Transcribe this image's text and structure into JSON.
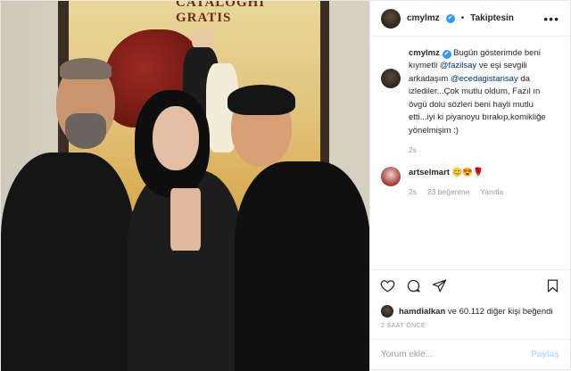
{
  "poster": {
    "text": "CATALOGHI GRATIS"
  },
  "header": {
    "username": "cmylmz",
    "verified": "✔",
    "separator": "•",
    "follow_label": "Takiptesin",
    "menu": "•••"
  },
  "caption": {
    "username": "cmylmz",
    "verified": "✔",
    "text_1": "Bugün gösterimde beni kıymetli",
    "mention_1": "@fazilsay",
    "text_2": "ve eşi sevgili arkadaşım",
    "mention_2": "@ecedagistansay",
    "text_3": "da izlediler...Çok mutlu oldum, Fazıl ın övgü dolu sözleri beni hayli mutlu etti...iyi ki piyanoyu bırakıp,komikliğe yönelmişim :)",
    "age": "2s"
  },
  "comments": [
    {
      "username": "artselmart",
      "text": "😊😍🌹",
      "age": "2s",
      "likes": "23 beğenme",
      "reply": "Yanıtla"
    }
  ],
  "icons": {
    "like": "heart-icon",
    "comment": "comment-icon",
    "share": "share-icon",
    "save": "bookmark-icon"
  },
  "likes": {
    "first_user": "hamdialkan",
    "text": "ve 60.112 diğer kişi beğendi"
  },
  "timestamp": "2 SAAT ÖNCE",
  "composer": {
    "placeholder": "Yorum ekle...",
    "post_label": "Paylaş"
  },
  "colors": {
    "accent": "#3897f0",
    "mention": "#003569",
    "muted": "#999999",
    "post_disabled": "#b2dffc"
  }
}
